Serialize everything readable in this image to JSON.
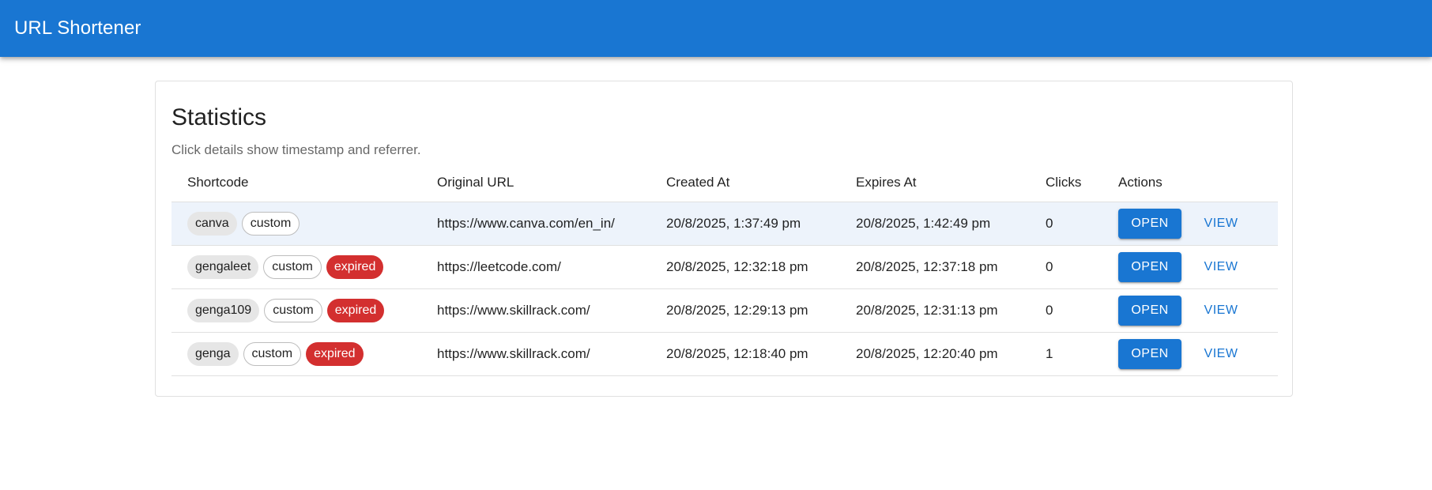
{
  "appbar": {
    "title": "URL Shortener"
  },
  "card": {
    "title": "Statistics",
    "subtitle": "Click details show timestamp and referrer."
  },
  "table": {
    "headers": {
      "shortcode": "Shortcode",
      "original_url": "Original URL",
      "created_at": "Created At",
      "expires_at": "Expires At",
      "clicks": "Clicks",
      "actions": "Actions"
    },
    "rows": [
      {
        "code": "canva",
        "tag": "custom",
        "status": "",
        "url": "https://www.canva.com/en_in/",
        "created": "20/8/2025, 1:37:49 pm",
        "expires": "20/8/2025, 1:42:49 pm",
        "clicks": "0",
        "open_label": "OPEN",
        "view_label": "VIEW"
      },
      {
        "code": "gengaleet",
        "tag": "custom",
        "status": "expired",
        "url": "https://leetcode.com/",
        "created": "20/8/2025, 12:32:18 pm",
        "expires": "20/8/2025, 12:37:18 pm",
        "clicks": "0",
        "open_label": "OPEN",
        "view_label": "VIEW"
      },
      {
        "code": "genga109",
        "tag": "custom",
        "status": "expired",
        "url": "https://www.skillrack.com/",
        "created": "20/8/2025, 12:29:13 pm",
        "expires": "20/8/2025, 12:31:13 pm",
        "clicks": "0",
        "open_label": "OPEN",
        "view_label": "VIEW"
      },
      {
        "code": "genga",
        "tag": "custom",
        "status": "expired",
        "url": "https://www.skillrack.com/",
        "created": "20/8/2025, 12:18:40 pm",
        "expires": "20/8/2025, 12:20:40 pm",
        "clicks": "1",
        "open_label": "OPEN",
        "view_label": "VIEW"
      }
    ]
  },
  "colors": {
    "primary": "#1976d2",
    "expired": "#d32f2f",
    "selected_row": "#edf3fb"
  }
}
